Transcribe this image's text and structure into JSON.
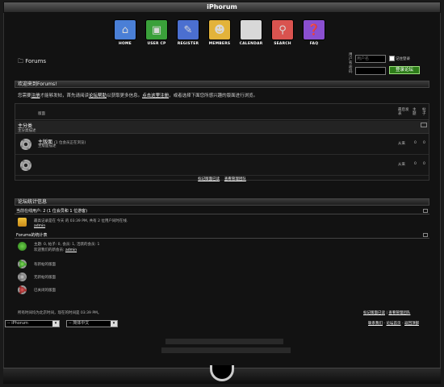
{
  "app_title": "iPhorum",
  "nav": [
    {
      "label": "HOME",
      "icon": "home-icon",
      "color": "#4a7fd6",
      "glyph": "⌂"
    },
    {
      "label": "USER CP",
      "icon": "user-cp-icon",
      "color": "#3aa03a",
      "glyph": "▣"
    },
    {
      "label": "REGISTER",
      "icon": "register-icon",
      "color": "#4b6fd0",
      "glyph": "✎"
    },
    {
      "label": "MEMBERS",
      "icon": "members-icon",
      "color": "#e3b33a",
      "glyph": "☻"
    },
    {
      "label": "CALENDAR",
      "icon": "calendar-icon",
      "color": "#d8d8d8",
      "glyph": "▦"
    },
    {
      "label": "SEARCH",
      "icon": "search-icon",
      "color": "#d9534f",
      "glyph": "⚲"
    },
    {
      "label": "FAQ",
      "icon": "faq-icon",
      "color": "#8a4fd0",
      "glyph": "❓"
    }
  ],
  "header": {
    "title": "Forums",
    "username_label": "用户名",
    "username_placeholder": "用户名",
    "password_label": "密码",
    "remember_label": "记住登录",
    "login_button": "登录论坛"
  },
  "welcome": {
    "bar": "欢迎来到Forums!",
    "text_a": "您需要",
    "register_link": "注册",
    "text_b": "才能够发帖，首先请阅读",
    "faq_link": "论坛帮助",
    "text_c": "以获取更多信息。",
    "click_link": "点击这里注册",
    "text_d": "，或者选择下面您所感兴趣的版面进行浏览。"
  },
  "table": {
    "col_forum": "版面",
    "col_last": "最后发表",
    "col_topics": "主题",
    "col_posts": "帖子",
    "category": "主分类",
    "category_desc": "主分类描述",
    "forums": [
      {
        "name": "主版面",
        "viewers": "(1 位会员正在浏览)",
        "desc": "主版面描述",
        "last": "从来",
        "topics": "0",
        "posts": "0"
      },
      {
        "name": "",
        "viewers": "",
        "desc": "",
        "last": "从来",
        "topics": "0",
        "posts": "0"
      }
    ],
    "mark_read": "标记版面已读",
    "view_leaders": "查看管理团队"
  },
  "stats": {
    "bar": "论坛统计信息",
    "online_header": "当前在线用户: 2 (1 位会员和 1 位游客)",
    "online_line": "最高记录是在 今天 的 03:39 PM, 共有 2 位用户同时在线.",
    "online_user": "admin",
    "forum_stats_header": "Forums的统计表",
    "forum_stats_line": "主题: 0, 帖子: 0, 会员: 1, 活跃的会员: 1",
    "newest_member_text": "欢迎我们的新会员:",
    "newest_member": "admin",
    "legend": [
      "有新帖的版面",
      "无新帖的版面",
      "已关闭的版面"
    ]
  },
  "footer": {
    "timezone": "所有时间均为北京时间，现在的时间是 03:39 PM。",
    "mark_read": "标记版面已读",
    "view_leaders": "查看管理团队",
    "style_select": "-- iPhorum",
    "lang_select": "-- 简体中文",
    "contact": "联系我们",
    "home": "论坛首页",
    "top": "返回顶部"
  }
}
